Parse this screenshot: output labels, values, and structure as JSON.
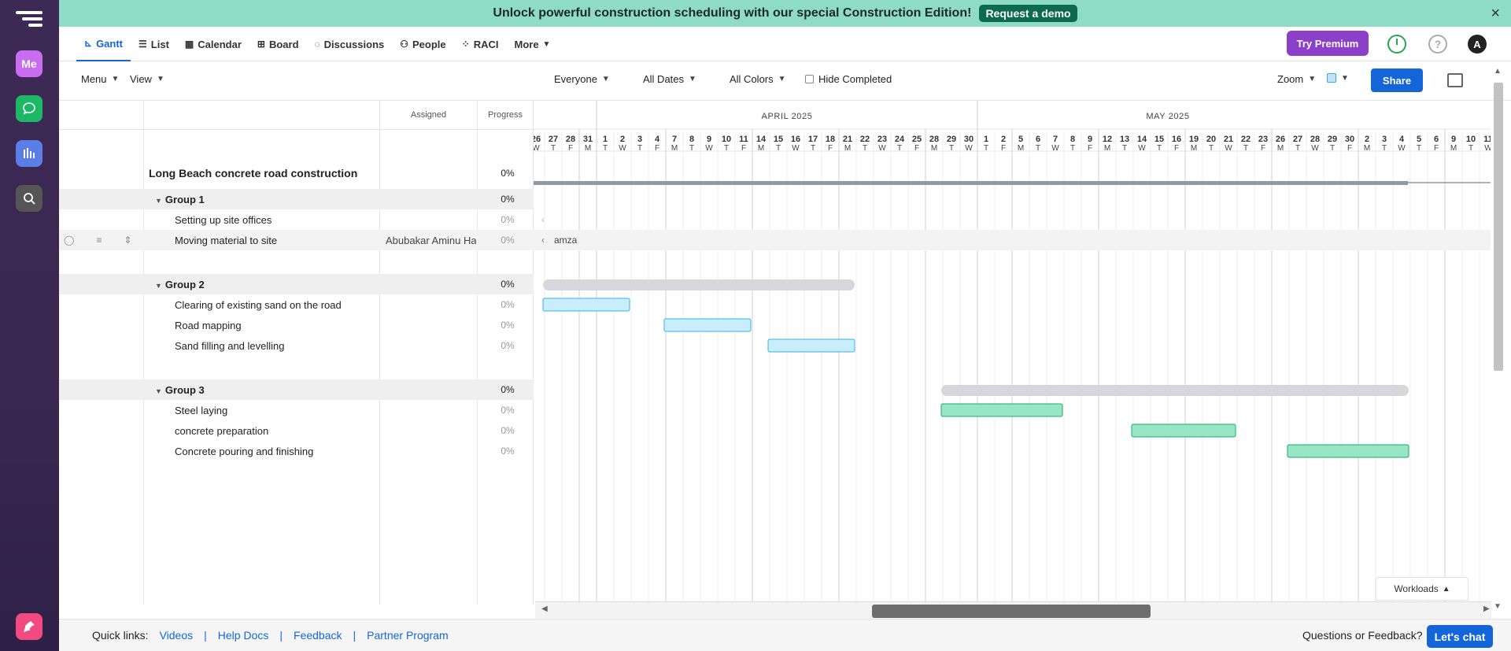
{
  "banner": {
    "message": "Unlock powerful construction scheduling with our special Construction Edition!",
    "cta": "Request a demo",
    "close_glyph": "×"
  },
  "rail": {
    "me_label": "Me"
  },
  "nav": {
    "tabs": [
      {
        "label": "Gantt",
        "icon": "gantt-icon",
        "active": true
      },
      {
        "label": "List",
        "icon": "list-icon"
      },
      {
        "label": "Calendar",
        "icon": "calendar-icon"
      },
      {
        "label": "Board",
        "icon": "board-icon"
      },
      {
        "label": "Discussions",
        "icon": "discussions-icon"
      },
      {
        "label": "People",
        "icon": "people-icon"
      },
      {
        "label": "RACI",
        "icon": "raci-icon"
      },
      {
        "label": "More",
        "icon": "chevron-down-icon"
      }
    ],
    "premium": "Try Premium",
    "help": "?",
    "avatar": "A"
  },
  "toolbar": {
    "menu": "Menu",
    "view": "View",
    "everyone": "Everyone",
    "dates": "All Dates",
    "colors": "All Colors",
    "hide_completed": "Hide Completed",
    "zoom": "Zoom",
    "share": "Share"
  },
  "grid": {
    "assigned_header": "Assigned",
    "progress_header": "Progress"
  },
  "timeline": {
    "months": [
      {
        "label": "APRIL 2025",
        "start_index": 4,
        "end_index": 26
      },
      {
        "label": "MAY 2025",
        "start_index": 26,
        "end_index": 48
      }
    ],
    "days": [
      {
        "d": "26",
        "w": "W"
      },
      {
        "d": "27",
        "w": "T"
      },
      {
        "d": "28",
        "w": "F"
      },
      {
        "d": "31",
        "w": "M"
      },
      {
        "d": "1",
        "w": "T"
      },
      {
        "d": "2",
        "w": "W"
      },
      {
        "d": "3",
        "w": "T"
      },
      {
        "d": "4",
        "w": "F"
      },
      {
        "d": "7",
        "w": "M"
      },
      {
        "d": "8",
        "w": "T"
      },
      {
        "d": "9",
        "w": "W"
      },
      {
        "d": "10",
        "w": "T"
      },
      {
        "d": "11",
        "w": "F"
      },
      {
        "d": "14",
        "w": "M"
      },
      {
        "d": "15",
        "w": "T"
      },
      {
        "d": "16",
        "w": "W"
      },
      {
        "d": "17",
        "w": "T"
      },
      {
        "d": "18",
        "w": "F"
      },
      {
        "d": "21",
        "w": "M"
      },
      {
        "d": "22",
        "w": "T"
      },
      {
        "d": "23",
        "w": "W"
      },
      {
        "d": "24",
        "w": "T"
      },
      {
        "d": "25",
        "w": "F"
      },
      {
        "d": "28",
        "w": "M"
      },
      {
        "d": "29",
        "w": "T"
      },
      {
        "d": "30",
        "w": "W"
      },
      {
        "d": "1",
        "w": "T"
      },
      {
        "d": "2",
        "w": "F"
      },
      {
        "d": "5",
        "w": "M"
      },
      {
        "d": "6",
        "w": "T"
      },
      {
        "d": "7",
        "w": "W"
      },
      {
        "d": "8",
        "w": "T"
      },
      {
        "d": "9",
        "w": "F"
      },
      {
        "d": "12",
        "w": "M"
      },
      {
        "d": "13",
        "w": "T"
      },
      {
        "d": "14",
        "w": "W"
      },
      {
        "d": "15",
        "w": "T"
      },
      {
        "d": "16",
        "w": "F"
      },
      {
        "d": "19",
        "w": "M"
      },
      {
        "d": "20",
        "w": "T"
      },
      {
        "d": "21",
        "w": "W"
      },
      {
        "d": "22",
        "w": "T"
      },
      {
        "d": "23",
        "w": "F"
      },
      {
        "d": "26",
        "w": "M"
      },
      {
        "d": "27",
        "w": "T"
      },
      {
        "d": "28",
        "w": "W"
      },
      {
        "d": "29",
        "w": "T"
      },
      {
        "d": "30",
        "w": "F"
      },
      {
        "d": "2",
        "w": "M"
      },
      {
        "d": "3",
        "w": "T"
      },
      {
        "d": "4",
        "w": "W"
      },
      {
        "d": "5",
        "w": "T"
      },
      {
        "d": "6",
        "w": "F"
      },
      {
        "d": "9",
        "w": "M"
      },
      {
        "d": "10",
        "w": "T"
      },
      {
        "d": "11",
        "w": "W"
      }
    ],
    "inline_assignee_fragment": "amza"
  },
  "project": {
    "name": "Long Beach concrete road construction",
    "progress": "0%"
  },
  "rows": [
    {
      "type": "group",
      "name": "Group 1",
      "progress": "0%"
    },
    {
      "type": "task",
      "name": "Setting up site offices",
      "assignee": "",
      "progress": "0%"
    },
    {
      "type": "task",
      "name": "Moving material to site",
      "assignee": "Abubakar Aminu Hamza",
      "progress": "0%"
    },
    {
      "type": "spacer"
    },
    {
      "type": "group",
      "name": "Group 2",
      "progress": "0%",
      "bar": {
        "start": 0,
        "end": 18
      }
    },
    {
      "type": "task",
      "name": "Clearing of existing sand on the road",
      "assignee": "",
      "progress": "0%",
      "bar": {
        "start": 0,
        "end": 5
      },
      "color": "blue"
    },
    {
      "type": "task",
      "name": "Road mapping",
      "assignee": "",
      "progress": "0%",
      "bar": {
        "start": 7,
        "end": 12
      },
      "color": "blue"
    },
    {
      "type": "task",
      "name": "Sand filling and levelling",
      "assignee": "",
      "progress": "0%",
      "bar": {
        "start": 13,
        "end": 18
      },
      "color": "blue"
    },
    {
      "type": "spacer"
    },
    {
      "type": "group",
      "name": "Group 3",
      "progress": "0%",
      "bar": {
        "start": 23,
        "end": 50
      }
    },
    {
      "type": "task",
      "name": "Steel laying",
      "assignee": "",
      "progress": "0%",
      "bar": {
        "start": 23,
        "end": 30
      },
      "color": "green"
    },
    {
      "type": "task",
      "name": "concrete preparation",
      "assignee": "",
      "progress": "0%",
      "bar": {
        "start": 34,
        "end": 40
      },
      "color": "green"
    },
    {
      "type": "task",
      "name": "Concrete pouring and finishing",
      "assignee": "",
      "progress": "0%",
      "bar": {
        "start": 43,
        "end": 50
      },
      "color": "green"
    }
  ],
  "workloads": "Workloads",
  "footer": {
    "quick_links_label": "Quick links:",
    "links": [
      "Videos",
      "Help Docs",
      "Feedback",
      "Partner Program"
    ],
    "separator": "|",
    "question": "Questions or Feedback?",
    "chat": "Let's chat"
  },
  "colors": {
    "accent": "#1466d8",
    "premium": "#8c3fc8",
    "task_blue_fill": "#c8eefb",
    "task_blue_border": "#3ab2e0",
    "task_green_fill": "#96e5c4",
    "task_green_border": "#22a86c",
    "group_bar": "#d6d6dc",
    "project_bar": "#8e9aa4"
  }
}
